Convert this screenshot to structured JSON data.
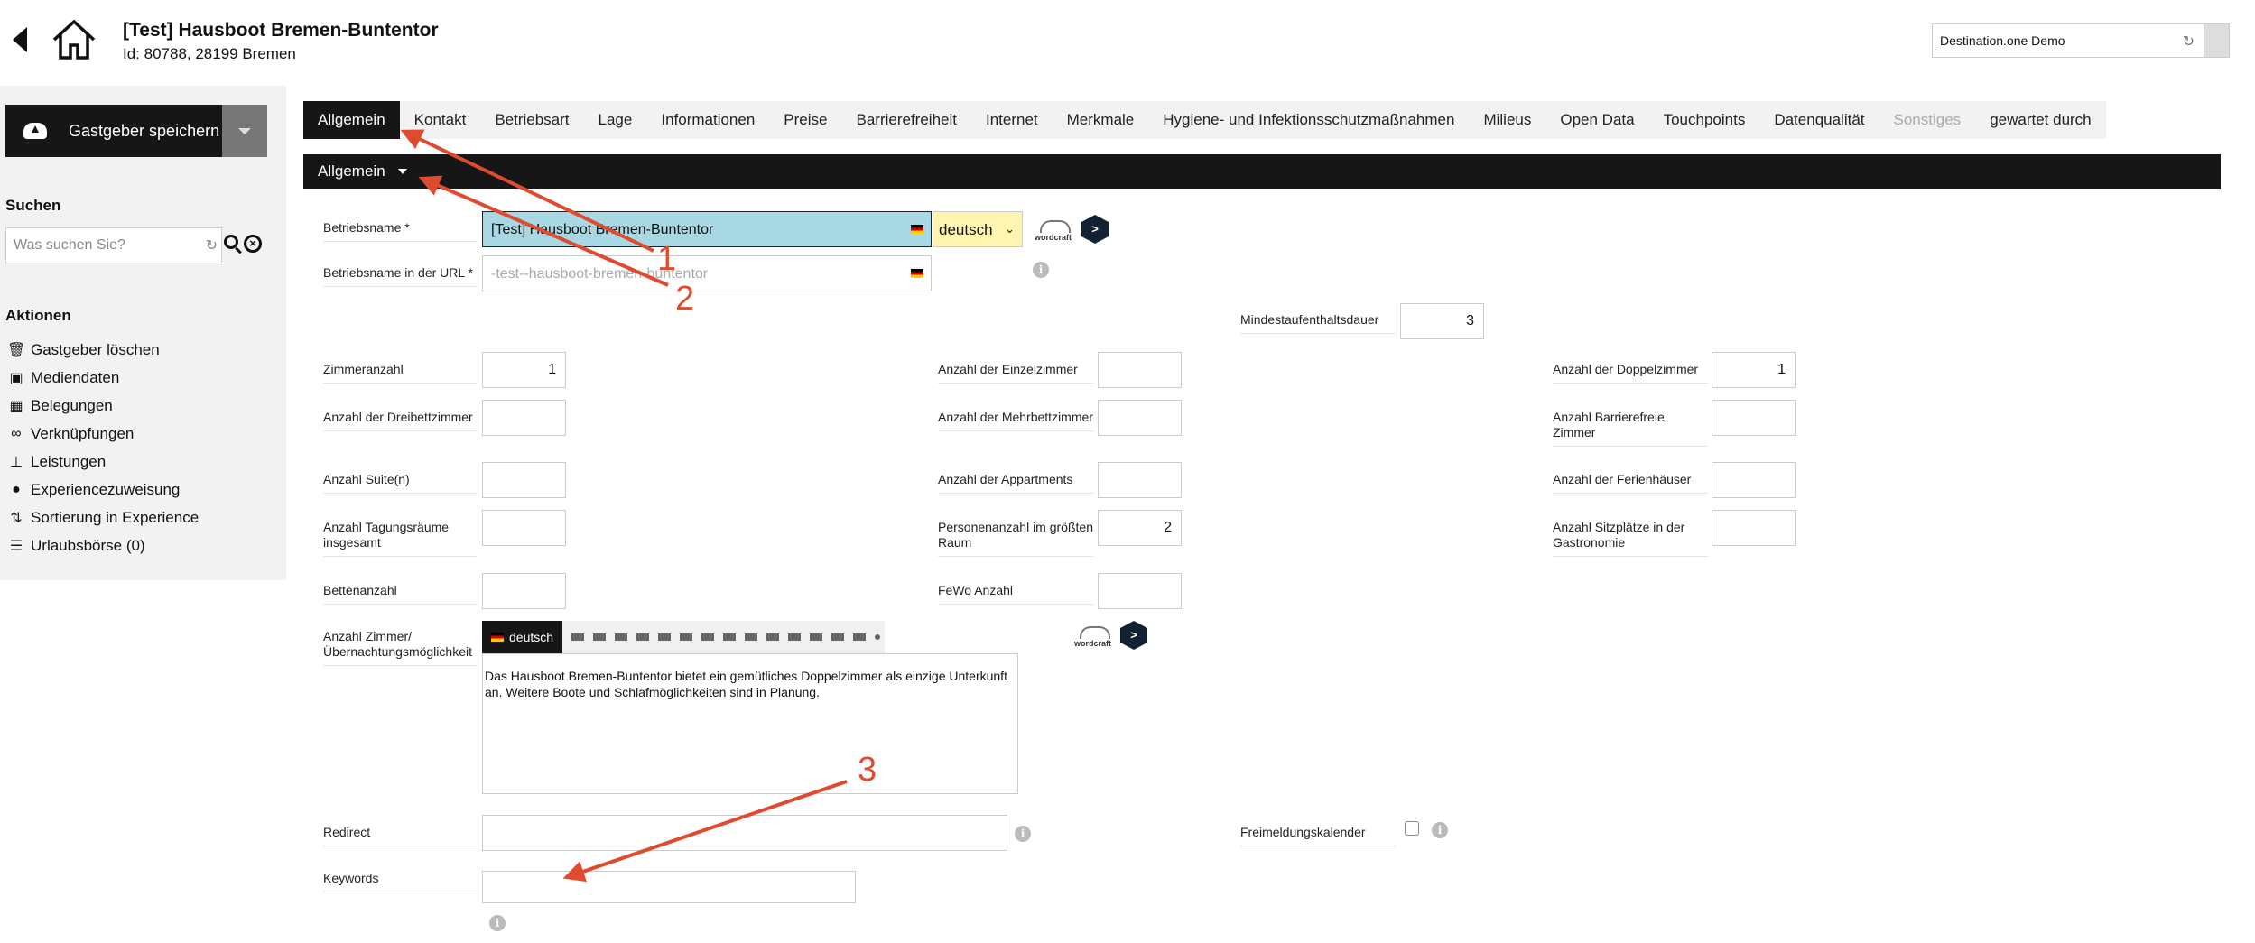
{
  "header": {
    "title": "[Test] Hausboot Bremen-Buntentor",
    "subtitle": "Id: 80788, 28199 Bremen",
    "destination": "Destination.one Demo"
  },
  "sidebar": {
    "save_label": "Gastgeber speichern",
    "search_heading": "Suchen",
    "search_placeholder": "Was suchen Sie?",
    "actions_heading": "Aktionen",
    "actions": [
      {
        "label": "Gastgeber löschen",
        "icon": "trash-icon"
      },
      {
        "label": "Mediendaten",
        "icon": "image-icon"
      },
      {
        "label": "Belegungen",
        "icon": "calendar-icon"
      },
      {
        "label": "Verknüpfungen",
        "icon": "link-icon"
      },
      {
        "label": "Leistungen",
        "icon": "sitemap-icon"
      },
      {
        "label": "Experiencezuweisung",
        "icon": "globe-icon"
      },
      {
        "label": "Sortierung in Experience",
        "icon": "sort-icon"
      },
      {
        "label": "Urlaubsbörse (0)",
        "icon": "list-icon"
      }
    ]
  },
  "tabs": [
    {
      "label": "Allgemein",
      "state": "active"
    },
    {
      "label": "Kontakt",
      "state": "normal"
    },
    {
      "label": "Betriebsart",
      "state": "normal"
    },
    {
      "label": "Lage",
      "state": "normal"
    },
    {
      "label": "Informationen",
      "state": "normal"
    },
    {
      "label": "Preise",
      "state": "normal"
    },
    {
      "label": "Barrierefreiheit",
      "state": "normal"
    },
    {
      "label": "Internet",
      "state": "normal"
    },
    {
      "label": "Merkmale",
      "state": "normal"
    },
    {
      "label": "Hygiene- und Infektionsschutzmaßnahmen",
      "state": "normal"
    },
    {
      "label": "Milieus",
      "state": "normal"
    },
    {
      "label": "Open Data",
      "state": "normal"
    },
    {
      "label": "Touchpoints",
      "state": "normal"
    },
    {
      "label": "Datenqualität",
      "state": "normal"
    },
    {
      "label": "Sonstiges",
      "state": "disabled"
    },
    {
      "label": "gewartet durch",
      "state": "normal"
    }
  ],
  "section": {
    "label": "Allgemein"
  },
  "form": {
    "betriebsname_label": "Betriebsname *",
    "betriebsname_value": "[Test] Hausboot Bremen-Buntentor",
    "language": "deutsch",
    "url_label": "Betriebsname in der URL *",
    "url_placeholder": "-test--hausboot-bremen-buntentor",
    "wordcraft": "wordcraft",
    "deepl": ">",
    "info": "i",
    "mindest_label": "Mindestaufenthaltsdauer",
    "mindest_value": "3",
    "zimmeranzahl_label": "Zimmeranzahl",
    "zimmeranzahl_value": "1",
    "einzel_label": "Anzahl der Einzelzimmer",
    "einzel_value": "",
    "doppel_label": "Anzahl der Doppelzimmer",
    "doppel_value": "1",
    "dreibett_label": "Anzahl der Dreibettzimmer",
    "mehrbett_label": "Anzahl der Mehrbettzimmer",
    "barrierefrei_label": "Anzahl Barrierefreie Zimmer",
    "suite_label": "Anzahl Suite(n)",
    "appartments_label": "Anzahl der Appartments",
    "ferienhaeuser_label": "Anzahl der Ferienhäuser",
    "tagung_label": "Anzahl Tagungsräume insgesamt",
    "personen_label": "Personenanzahl im größten Raum",
    "personen_value": "2",
    "sitzplaetze_label": "Anzahl Sitzplätze in der Gastronomie",
    "betten_label": "Bettenanzahl",
    "fewo_label": "FeWo Anzahl",
    "zimmer_text_label": "Anzahl Zimmer/ Übernachtungsmöglichkeit",
    "editor_language": "deutsch",
    "editor_text": "Das Hausboot Bremen-Buntentor bietet ein gemütliches Doppelzimmer als einzige Unterkunft an. Weitere Boote und Schlafmöglichkeiten sind in Planung.",
    "redirect_label": "Redirect",
    "freimeldung_label": "Freimeldungskalender",
    "keywords_label": "Keywords"
  },
  "annotations": {
    "n1": "1",
    "n2": "2",
    "n3": "3",
    "color": "#e04b2f"
  },
  "colors": {
    "dark": "#161616",
    "highlight": "#a8d8e4",
    "language_yellow": "#fff5b0"
  }
}
